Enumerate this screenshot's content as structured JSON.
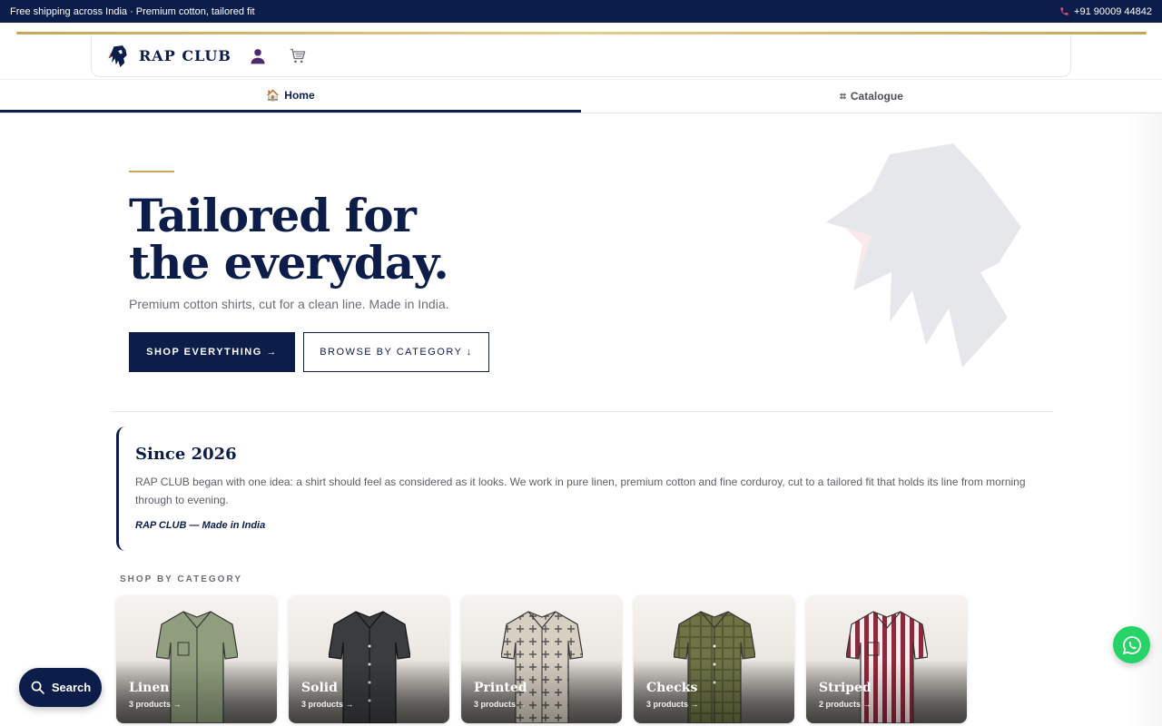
{
  "topbar": {
    "announcement": "Free shipping across India · Premium cotton, tailored fit",
    "phone": "+91 90009 44842"
  },
  "header": {
    "brand": "RAP CLUB",
    "icons": [
      "lion-logo-icon",
      "user-icon",
      "cart-icon"
    ]
  },
  "nav": {
    "tabs": [
      {
        "label": "Home",
        "icon": "home-icon",
        "active": true
      },
      {
        "label": "Catalogue",
        "icon": "grid-icon",
        "active": false
      }
    ]
  },
  "hero": {
    "title": "Tailored for the everyday.",
    "subtitle": "Premium cotton shirts, cut for a clean line. Made in India.",
    "primary_cta": "SHOP EVERYTHING →",
    "secondary_cta": "BROWSE BY CATEGORY ↓"
  },
  "story": {
    "heading": "Since 2026",
    "body": "RAP CLUB began with one idea: a shirt should feel as considered as it looks. We work in pure linen, premium cotton and fine corduroy, cut to a tailored fit that holds its line from morning through to evening.",
    "signature": "RAP CLUB — Made in India"
  },
  "categories": {
    "label": "SHOP BY CATEGORY",
    "items": [
      {
        "name": "Linen",
        "count": "3 products →",
        "color": "#8f9f7d"
      },
      {
        "name": "Solid",
        "count": "3 products →",
        "color": "#3a3c3f"
      },
      {
        "name": "Printed",
        "count": "3 products →",
        "color": "#d8cfc3"
      },
      {
        "name": "Checks",
        "count": "3 products →",
        "color": "#6e7446"
      },
      {
        "name": "Striped",
        "count": "2 products →",
        "color": "#8a2a3a"
      }
    ]
  },
  "floating": {
    "search_label": "Search"
  },
  "colors": {
    "navy": "#0c1d4a",
    "gold": "#c9a65a",
    "whatsapp": "#25d366"
  }
}
